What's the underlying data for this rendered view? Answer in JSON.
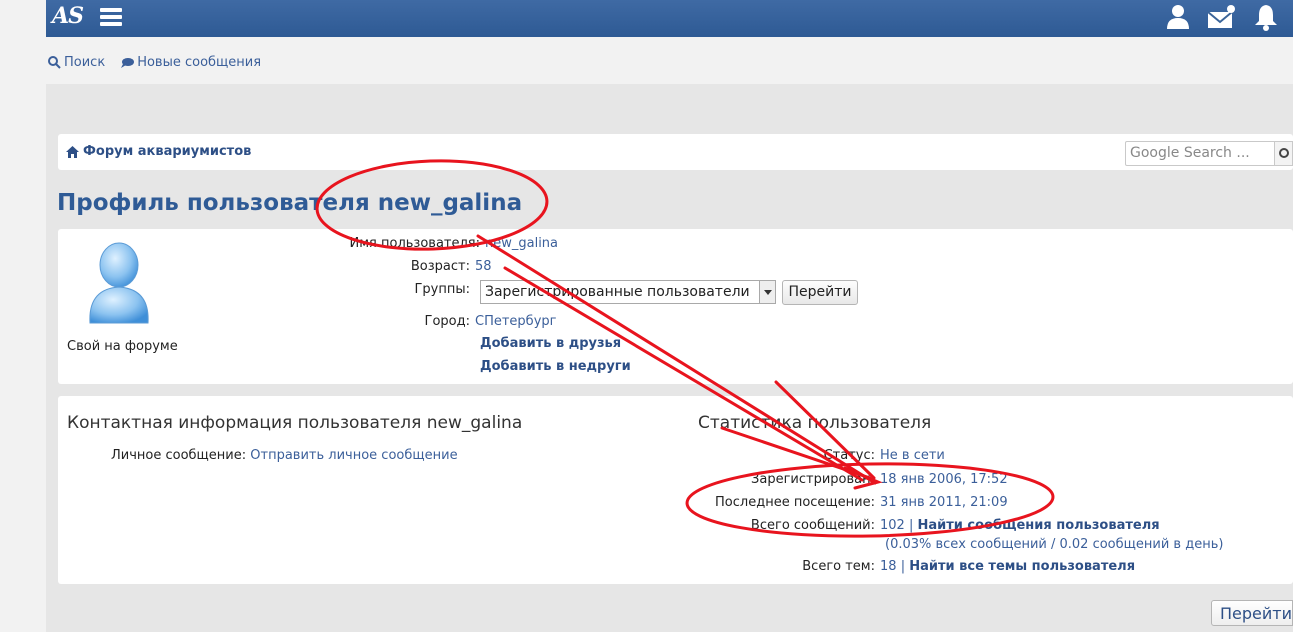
{
  "topbar": {
    "logo": "AS",
    "icons": [
      "hamburger-menu-icon",
      "user-icon",
      "mail-icon",
      "bell-icon"
    ],
    "accent": "#3a6499"
  },
  "subnav": {
    "search": "Поиск",
    "new_posts": "Новые сообщения"
  },
  "breadcrumb": {
    "home": "Форум аквариумистов"
  },
  "search": {
    "placeholder": "Google Search ..."
  },
  "profile": {
    "title": "Профиль пользователя new_galina",
    "avatar_caption": "Свой на форуме",
    "fields": {
      "username_label": "Имя пользователя:",
      "username": "new_galina",
      "age_label": "Возраст:",
      "age": "58",
      "groups_label": "Группы:",
      "group_selected": "Зарегистрированные пользователи",
      "go_button": "Перейти",
      "city_label": "Город:",
      "city": "СПетербург",
      "add_friend": "Добавить в друзья",
      "add_foe": "Добавить в недруги"
    }
  },
  "contact": {
    "title": "Контактная информация пользователя new_galina",
    "pm_label": "Личное сообщение:",
    "pm_link": "Отправить личное сообщение"
  },
  "stats": {
    "title": "Статистика пользователя",
    "status_label": "Статус:",
    "status": "Не в сети",
    "registered_label": "Зарегистрирован:",
    "registered": "18 янв 2006, 17:52",
    "last_visit_label": "Последнее посещение:",
    "last_visit": "31 янв 2011, 21:09",
    "posts_label": "Всего сообщений:",
    "posts": "102",
    "posts_link": "Найти сообщения пользователя",
    "posts_detail": "(0.03% всех сообщений / 0.02 сообщений в день)",
    "topics_label": "Всего тем:",
    "topics": "18",
    "topics_link": "Найти все темы пользователя",
    "sep": "|"
  },
  "footer": {
    "go_button": "Перейти"
  },
  "annotation": {
    "color": "#e8141e"
  }
}
